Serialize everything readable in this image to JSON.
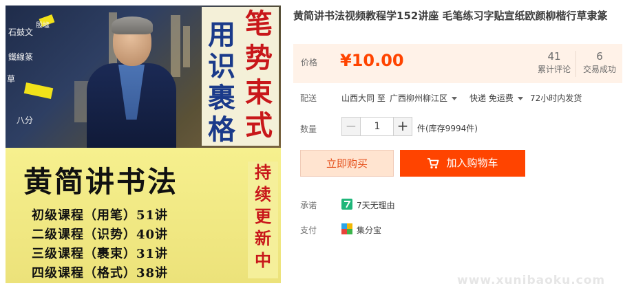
{
  "image": {
    "stickers": [
      "石鼓文",
      "殷墟",
      "鐵線篆",
      "草",
      "八分"
    ],
    "title_chars": [
      "笔",
      "用",
      "势",
      "识",
      "束",
      "裹",
      "式",
      "格"
    ],
    "banner_title": "黄简讲书法",
    "courses": [
      "初级课程（用笔）51讲",
      "二级课程（识势）40讲",
      "三级课程（裹束）31讲",
      "四级课程（格式）38讲"
    ],
    "update_chars": [
      "持",
      "续",
      "更",
      "新",
      "中"
    ]
  },
  "product": {
    "title": "黄简讲书法视频教程学152讲座 毛笔练习字贴宣纸欧颜柳楷行草隶篆"
  },
  "price": {
    "label": "价格",
    "value": "¥10.00",
    "review_count": "41",
    "review_label": "累计评论",
    "sold_count": "6",
    "sold_label": "交易成功"
  },
  "shipping": {
    "label": "配送",
    "origin": "山西大同 至",
    "destination": "广西柳州柳江区",
    "method": "快递 免运费",
    "dispatch": "72小时内发货"
  },
  "quantity": {
    "label": "数量",
    "minus": "−",
    "value": "1",
    "plus": "+",
    "stock": "件(库存9994件)"
  },
  "actions": {
    "buy_now": "立即购买",
    "add_to_cart": "加入购物车"
  },
  "promise": {
    "label": "承诺",
    "text": "7天无理由"
  },
  "payment": {
    "label": "支付",
    "text": "集分宝"
  },
  "colors": {
    "accent": "#ff4400",
    "price_bg": "#fff2e8",
    "buy_now_bg": "#ffe4d0"
  },
  "watermark": "www.xunibaoku.com"
}
